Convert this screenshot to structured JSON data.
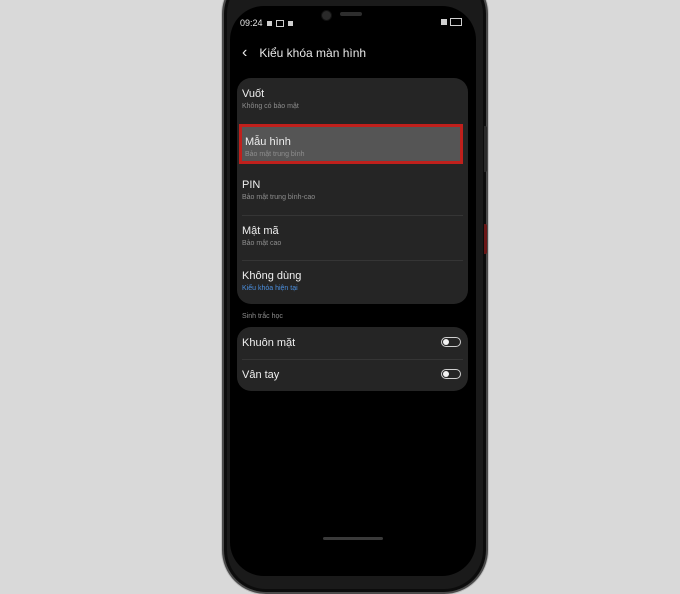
{
  "status": {
    "time": "09:24"
  },
  "header": {
    "back_icon": "chevron-left-icon",
    "title": "Kiểu khóa màn hình"
  },
  "lock_options": [
    {
      "label": "Vuốt",
      "subtitle": "Không có bảo mật"
    },
    {
      "label": "Mẫu hình",
      "subtitle": "Bảo mật trung bình",
      "highlighted": true
    },
    {
      "label": "PIN",
      "subtitle": "Bảo mật trung bình-cao"
    },
    {
      "label": "Mật mã",
      "subtitle": "Bảo mật cao"
    },
    {
      "label": "Không dùng",
      "subtitle": "Kiểu khóa hiện tại",
      "subtitle_color": "#4b8fdf"
    }
  ],
  "biometrics": {
    "section_label": "Sinh trắc học",
    "items": [
      {
        "label": "Khuôn mặt",
        "enabled": false
      },
      {
        "label": "Vân tay",
        "enabled": false
      }
    ]
  },
  "colors": {
    "highlight_border": "#c0201c",
    "current_subtitle": "#4b8fdf",
    "background": "#000000"
  }
}
